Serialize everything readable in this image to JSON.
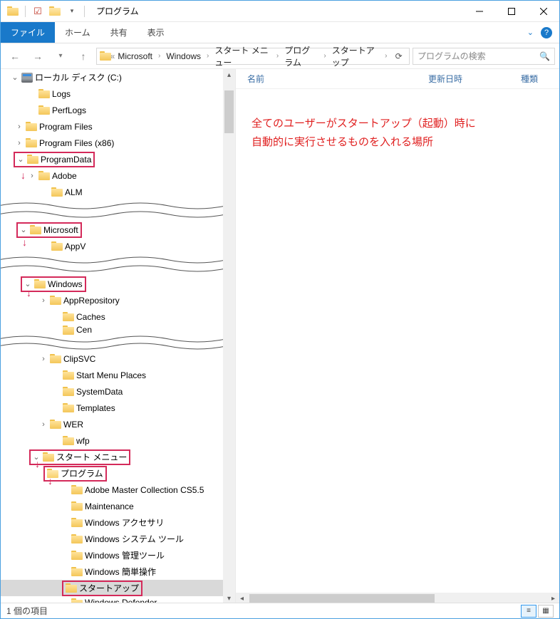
{
  "title": "プログラム",
  "tabs": {
    "file": "ファイル",
    "home": "ホーム",
    "share": "共有",
    "view": "表示"
  },
  "breadcrumbs": [
    "Microsoft",
    "Windows",
    "スタート メニュー",
    "プログラム",
    "スタートアップ"
  ],
  "search_placeholder": "プログラムの検索",
  "columns": {
    "name": "名前",
    "date": "更新日時",
    "type": "種類"
  },
  "annotation": {
    "line1": "全てのユーザーがスタートアップ（起動）時に",
    "line2": "自動的に実行させるものを入れる場所"
  },
  "tree": {
    "root": "ローカル ディスク (C:)",
    "level1": [
      "Logs",
      "PerfLogs",
      "Program Files",
      "Program Files (x86)",
      "ProgramData"
    ],
    "pd_children": [
      "Adobe",
      "ALM"
    ],
    "microsoft": "Microsoft",
    "ms_children": [
      "AppV"
    ],
    "windows": "Windows",
    "win_children_top": [
      "AppRepository",
      "Caches",
      "Cen"
    ],
    "win_children_bot": [
      "ClipSVC",
      "Start Menu Places",
      "SystemData",
      "Templates",
      "WER",
      "wfp"
    ],
    "startmenu": "スタート メニュー",
    "programs": "プログラム",
    "prog_children": [
      "Adobe Master Collection CS5.5",
      "Maintenance",
      "Windows アクセサリ",
      "Windows システム ツール",
      "Windows 管理ツール",
      "Windows 簡単操作"
    ],
    "startup": "スタートアップ",
    "after_startup": "Windows Defender"
  },
  "status": "1 個の項目"
}
